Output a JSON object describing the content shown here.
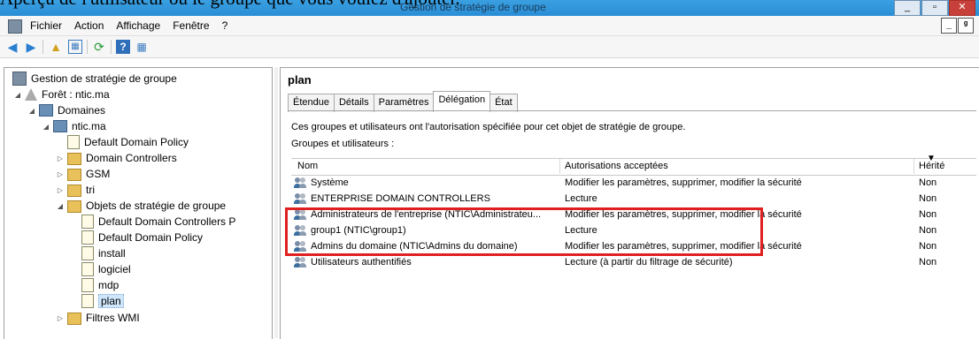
{
  "caption": "Aperçu de l'utilisateur ou le groupe que vous voulez d'ajouter.",
  "window": {
    "title": "Gestion de stratégie de groupe",
    "buttons": [
      "_",
      "▫",
      "✕"
    ]
  },
  "menubar": {
    "items": [
      "Fichier",
      "Action",
      "Affichage",
      "Fenêtre",
      "?"
    ],
    "inner_buttons": [
      "_",
      "ᵍ"
    ]
  },
  "toolbar": {
    "icons": [
      "back-arrow-icon",
      "forward-arrow-icon",
      "up-folder-icon",
      "show-tree-icon",
      "refresh-icon",
      "help-icon",
      "properties-icon"
    ]
  },
  "tree": {
    "root": "Gestion de stratégie de groupe",
    "forest": "Forêt : ntic.ma",
    "domains": "Domaines",
    "domain": "ntic.ma",
    "nodes": [
      {
        "label": "Default Domain Policy",
        "type": "link"
      },
      {
        "label": "Domain Controllers",
        "type": "ou"
      },
      {
        "label": "GSM",
        "type": "ou"
      },
      {
        "label": "tri",
        "type": "ou"
      },
      {
        "label": "Objets de stratégie de groupe",
        "type": "container"
      }
    ],
    "gpos": [
      "Default Domain Controllers P",
      "Default Domain Policy",
      "install",
      "logiciel",
      "mdp",
      "plan"
    ],
    "wmi": "Filtres WMI"
  },
  "detail": {
    "title": "plan",
    "tabs": [
      "Étendue",
      "Détails",
      "Paramètres",
      "Délégation",
      "État"
    ],
    "active_tab": "Délégation",
    "description": "Ces groupes et utilisateurs ont l'autorisation spécifiée pour cet objet de stratégie de groupe.",
    "groups_label": "Groupes et utilisateurs :",
    "columns": [
      "Nom",
      "Autorisations acceptées",
      "Hérité"
    ],
    "rows": [
      {
        "name": "Système",
        "perm": "Modifier les paramètres, supprimer, modifier la sécurité",
        "inherited": "Non"
      },
      {
        "name": "ENTERPRISE DOMAIN CONTROLLERS",
        "perm": "Lecture",
        "inherited": "Non"
      },
      {
        "name": "Administrateurs de l'entreprise (NTIC\\Administrateu...",
        "perm": "Modifier les paramètres, supprimer, modifier la sécurité",
        "inherited": "Non"
      },
      {
        "name": "group1 (NTIC\\group1)",
        "perm": "Lecture",
        "inherited": "Non"
      },
      {
        "name": "Admins du domaine (NTIC\\Admins du domaine)",
        "perm": "Modifier les paramètres, supprimer, modifier la sécurité",
        "inherited": "Non"
      },
      {
        "name": "Utilisateurs authentifiés",
        "perm": "Lecture (à partir du filtrage de sécurité)",
        "inherited": "Non"
      }
    ]
  },
  "colors": {
    "titlebar": "#2a8ed6",
    "highlight": "#e02020",
    "selection": "#cfe6fb"
  }
}
